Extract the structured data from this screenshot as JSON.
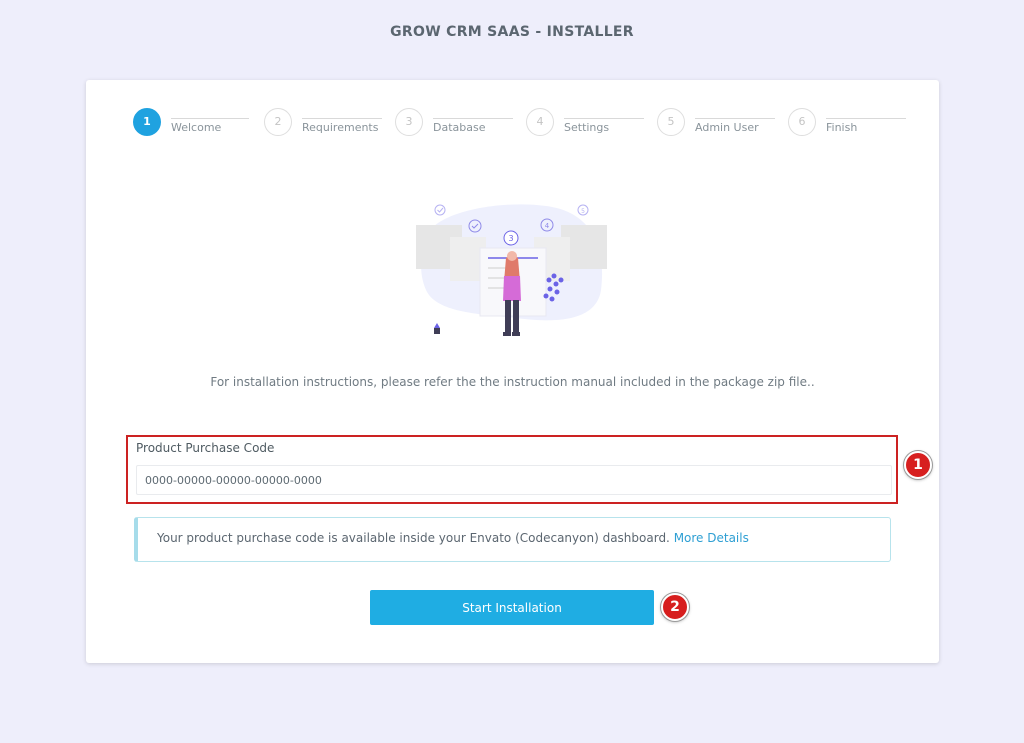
{
  "page": {
    "title": "GROW CRM SAAS - INSTALLER"
  },
  "steps": [
    {
      "number": "1",
      "label": "Welcome",
      "active": true
    },
    {
      "number": "2",
      "label": "Requirements",
      "active": false
    },
    {
      "number": "3",
      "label": "Database",
      "active": false
    },
    {
      "number": "4",
      "label": "Settings",
      "active": false
    },
    {
      "number": "5",
      "label": "Admin User",
      "active": false
    },
    {
      "number": "6",
      "label": "Finish",
      "active": false
    }
  ],
  "illustration": {
    "icon": "installer-steps-illustration",
    "step_badge_3": "3",
    "step_badge_4": "4",
    "step_badge_5": "5"
  },
  "main": {
    "instructions": "For installation instructions, please refer the the instruction manual included in the package zip file.."
  },
  "purchase_code": {
    "label": "Product Purchase Code",
    "value": "",
    "placeholder": "0000-00000-00000-00000-0000"
  },
  "alert": {
    "text": "Your product purchase code is available inside your Envato (Codecanyon) dashboard. ",
    "link": "More Details"
  },
  "buttons": {
    "start_label": "Start Installation"
  },
  "markers": {
    "one": "1",
    "two": "2"
  },
  "colors": {
    "accent": "#1fade3",
    "marker": "#d71f1f",
    "highlight_border": "#cc2222",
    "background": "#eeeefb"
  }
}
